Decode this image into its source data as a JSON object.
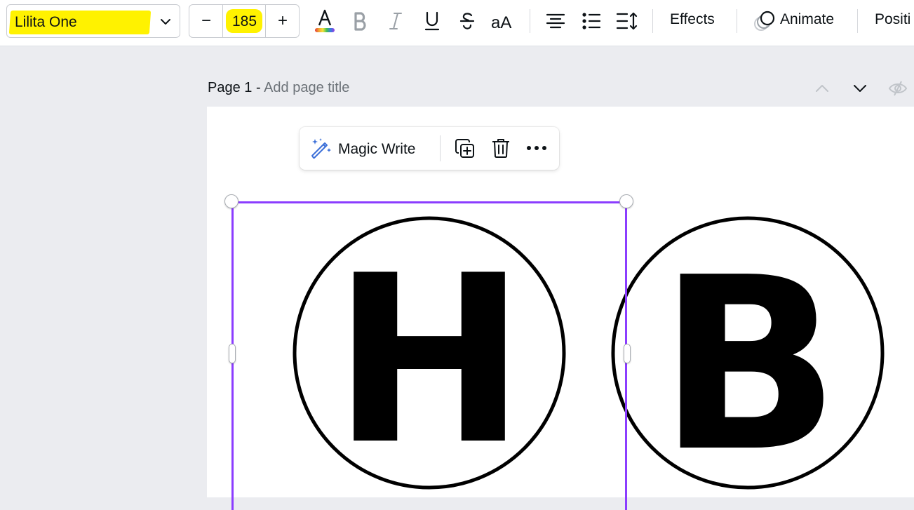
{
  "toolbar": {
    "font_name": "Lilita One",
    "font_size": "185",
    "decrease_label": "−",
    "increase_label": "+",
    "effects_label": "Effects",
    "animate_label": "Animate",
    "position_label": "Positi",
    "icons": [
      "chevron-down-icon",
      "text-color-icon",
      "bold-icon",
      "italic-icon",
      "underline-icon",
      "strikethrough-icon",
      "letter-case-icon",
      "align-center-icon",
      "bullet-list-icon",
      "spacing-icon",
      "animate-icon"
    ],
    "highlight_color": "#fff200"
  },
  "page": {
    "label": "Page 1 - ",
    "title_placeholder": "Add page title",
    "icons": [
      "chevron-up-icon",
      "chevron-down-icon",
      "hide-icon"
    ]
  },
  "float_bar": {
    "magic_write_label": "Magic Write",
    "icons": [
      "magic-write-icon",
      "duplicate-icon",
      "trash-icon",
      "more-icon"
    ]
  },
  "canvas": {
    "letters": [
      "H",
      "B"
    ],
    "selection_color": "#8b3dff"
  }
}
